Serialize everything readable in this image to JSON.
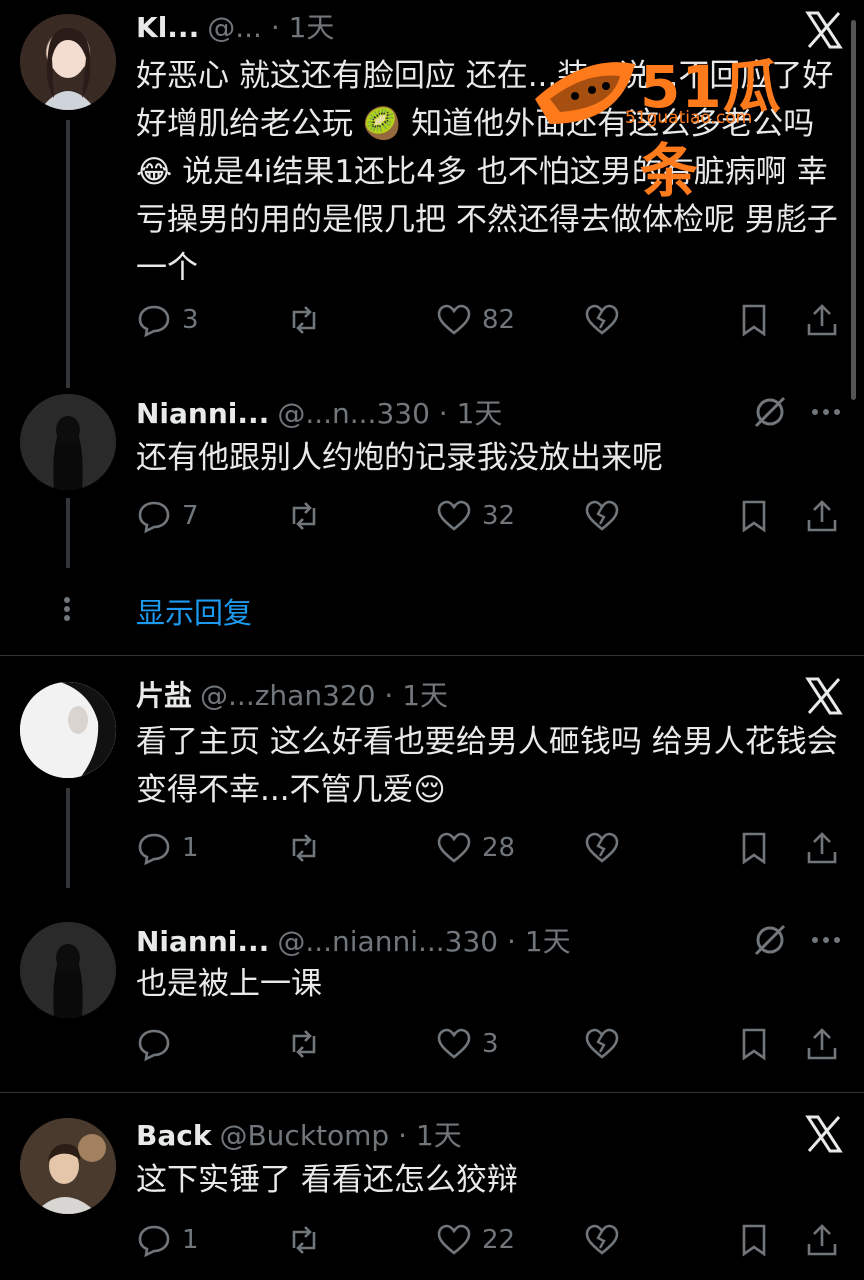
{
  "posts": [
    {
      "name": "Kl...",
      "handle": "@... · 1天",
      "text": "好恶心 就这还有脸回应 还在...装...说...不回应了好好增肌给老公玩 🥝 知道他外面还有这么多老公吗😂 说是4i结果1还比4多 也不怕这男的有脏病啊 幸亏操男的用的是假几把 不然还得去做体检呢 男彪子一个",
      "replies": "3",
      "retweets": "",
      "likes": "82",
      "corner_icon": "x-logo-icon"
    },
    {
      "name": "Nianni...",
      "handle": "@...n...330 · 1天",
      "text": "还有他跟别人约炮的记录我没放出来呢",
      "replies": "7",
      "retweets": "",
      "likes": "32",
      "corner_icon": "grok-icon"
    },
    {
      "name": "片盐",
      "handle": "@...zhan320 · 1天",
      "text": "看了主页 这么好看也要给男人砸钱吗 给男人花钱会变得不幸...不管几爱😌",
      "replies": "1",
      "retweets": "",
      "likes": "28",
      "corner_icon": "x-logo-icon"
    },
    {
      "name": "Nianni...",
      "handle": "@...nianni...330 · 1天",
      "text": "也是被上一课",
      "replies": "",
      "retweets": "",
      "likes": "3",
      "corner_icon": "grok-icon"
    },
    {
      "name": "Back",
      "handle": "@Bucktomp · 1天",
      "text": "这下实锤了 看看还怎么狡辩",
      "replies": "1",
      "retweets": "",
      "likes": "22",
      "corner_icon": "x-logo-icon"
    }
  ],
  "show_replies": "显示回复",
  "watermark": {
    "main": "51瓜条",
    "sub": "51guatiao.com"
  },
  "colors": {
    "background": "#000000",
    "text": "#e7e9ea",
    "muted": "#71767b",
    "link": "#1d9bf0",
    "watermark": "#ff7a1a"
  }
}
